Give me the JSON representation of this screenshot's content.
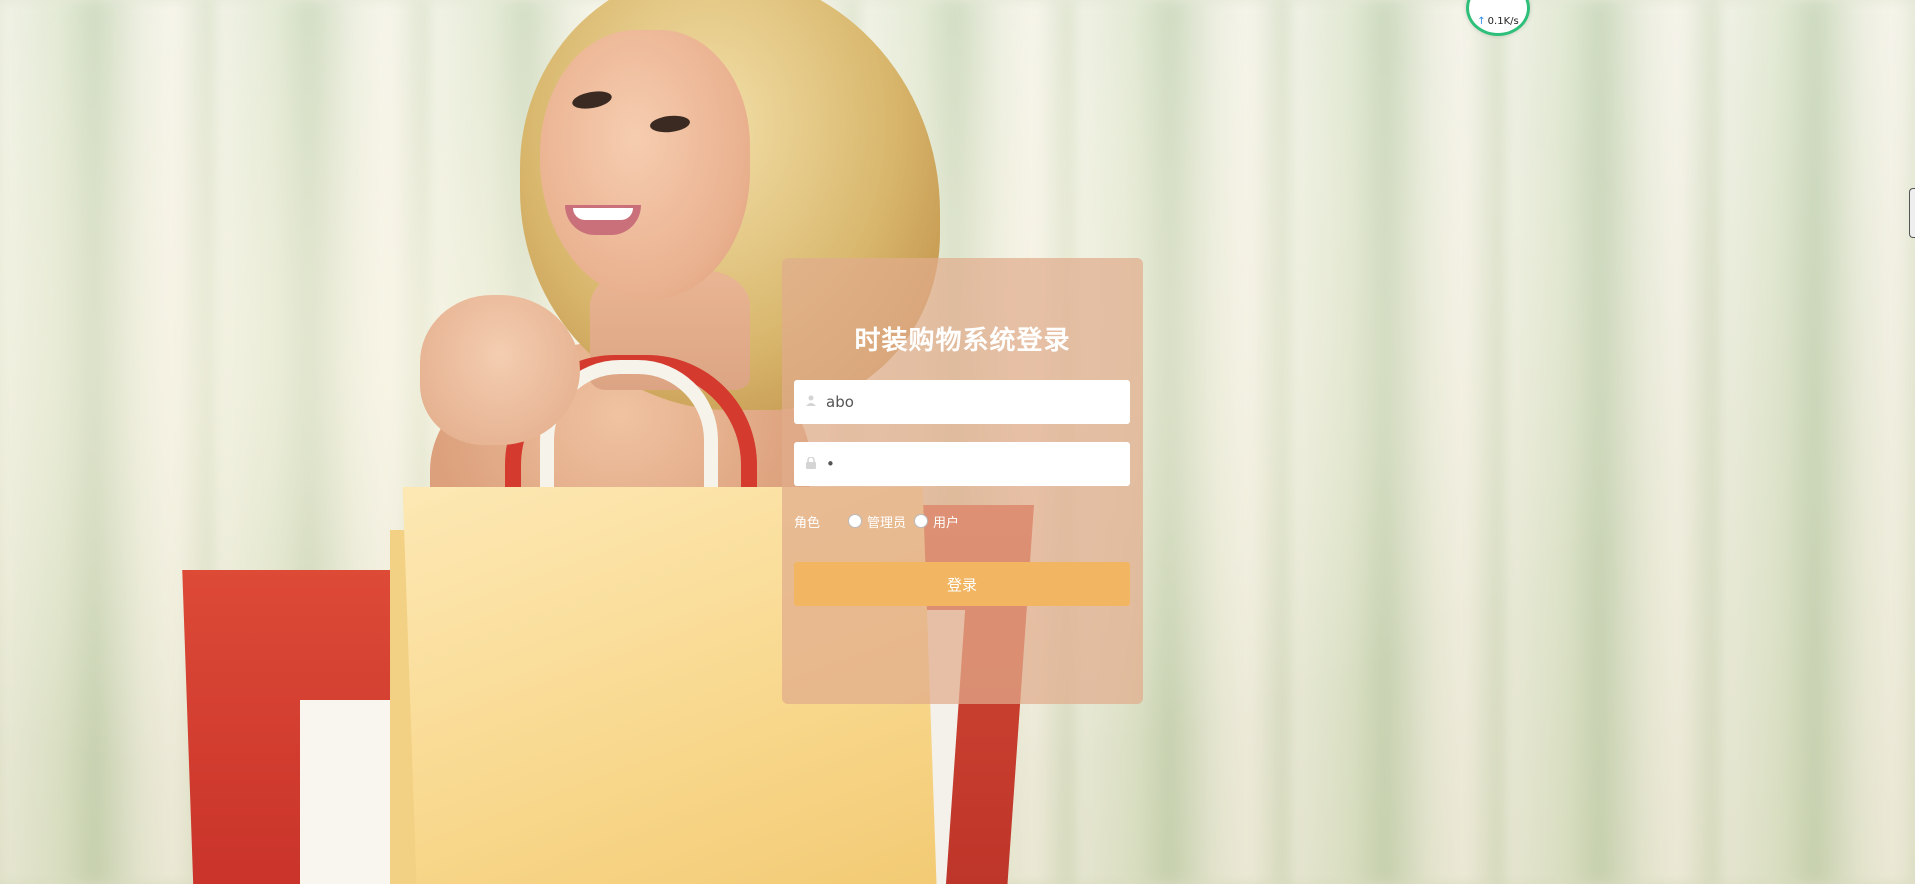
{
  "speed_widget": {
    "value": "0.1K/s",
    "icon": "upload-arrow-icon"
  },
  "login": {
    "title": "时装购物系统登录",
    "username": {
      "value": "abo",
      "icon": "user-icon"
    },
    "password": {
      "masked_value": "•",
      "icon": "lock-icon"
    },
    "role": {
      "label": "角色",
      "options": [
        "管理员",
        "用户"
      ],
      "selected": null
    },
    "submit_label": "登录"
  },
  "colors": {
    "panel": "#e0ac8c",
    "button": "#f2b562",
    "speed_ring": "#2ec07a"
  }
}
